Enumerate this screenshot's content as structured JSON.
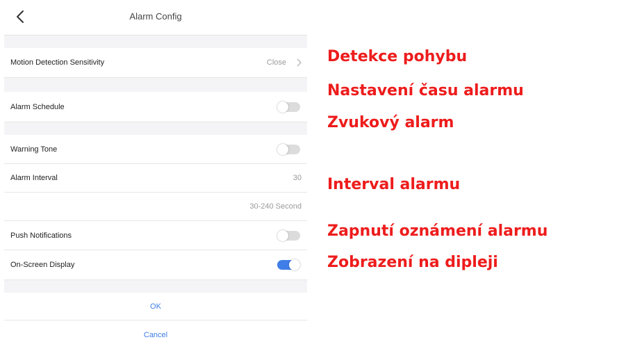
{
  "header": {
    "title": "Alarm Config"
  },
  "settings": {
    "motion": {
      "label": "Motion Detection Sensitivity",
      "value": "Close"
    },
    "schedule": {
      "label": "Alarm Schedule",
      "enabled": false
    },
    "warning_tone": {
      "label": "Warning Tone",
      "enabled": false
    },
    "interval": {
      "label": "Alarm Interval",
      "value": "30",
      "hint": "30-240 Second"
    },
    "push": {
      "label": "Push Notifications",
      "enabled": false
    },
    "osd": {
      "label": "On-Screen Display",
      "enabled": true
    }
  },
  "buttons": {
    "ok": "OK",
    "cancel": "Cancel"
  },
  "annotations": [
    "Detekce pohybu",
    "Nastavení času alarmu",
    "Zvukový alarm",
    "Interval alarmu",
    "Zapnutí oznámení alarmu",
    "Zobrazení na dipleji"
  ],
  "colors": {
    "accent": "#3f7ee8",
    "annotation": "#ee1c1c",
    "toggle_off": "#dcdcdc"
  }
}
